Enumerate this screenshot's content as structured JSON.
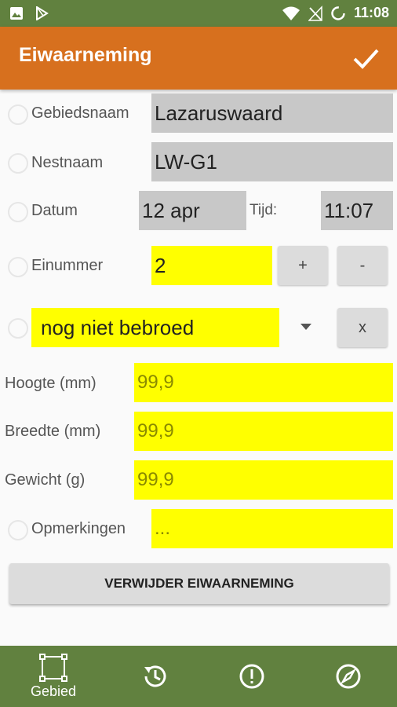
{
  "status_bar": {
    "time": "11:08"
  },
  "app_bar": {
    "title": "Eiwaarneming"
  },
  "form": {
    "gebiedsnaam": {
      "label": "Gebiedsnaam",
      "value": "Lazaruswaard"
    },
    "nestnaam": {
      "label": "Nestnaam",
      "value": "LW-G1"
    },
    "datum": {
      "label": "Datum",
      "value": "12 apr",
      "time_label": "Tijd:",
      "time_value": "11:07"
    },
    "einummer": {
      "label": "Einummer",
      "value": "2",
      "plus_label": "+",
      "minus_label": "-"
    },
    "status": {
      "value": "nog niet bebroed",
      "clear_label": "x"
    },
    "hoogte": {
      "label": "Hoogte (mm)",
      "placeholder": "99,9"
    },
    "breedte": {
      "label": "Breedte (mm)",
      "placeholder": "99,9"
    },
    "gewicht": {
      "label": "Gewicht (g)",
      "placeholder": "99,9"
    },
    "opmerkingen": {
      "label": "Opmerkingen",
      "placeholder": "..."
    }
  },
  "delete_button": {
    "label": "VERWIJDER EIWAARNEMING"
  },
  "bottom_nav": {
    "items": [
      {
        "label": "Gebied",
        "icon": "area-select-icon"
      },
      {
        "label": "",
        "icon": "history-icon"
      },
      {
        "label": "",
        "icon": "alert-icon"
      },
      {
        "label": "",
        "icon": "compass-icon"
      }
    ]
  },
  "colors": {
    "status_bar": "#61813f",
    "app_bar": "#d7701e",
    "field_gray": "#c8c8c8",
    "field_yellow": "#ffff00",
    "bottom_nav": "#61813f"
  }
}
